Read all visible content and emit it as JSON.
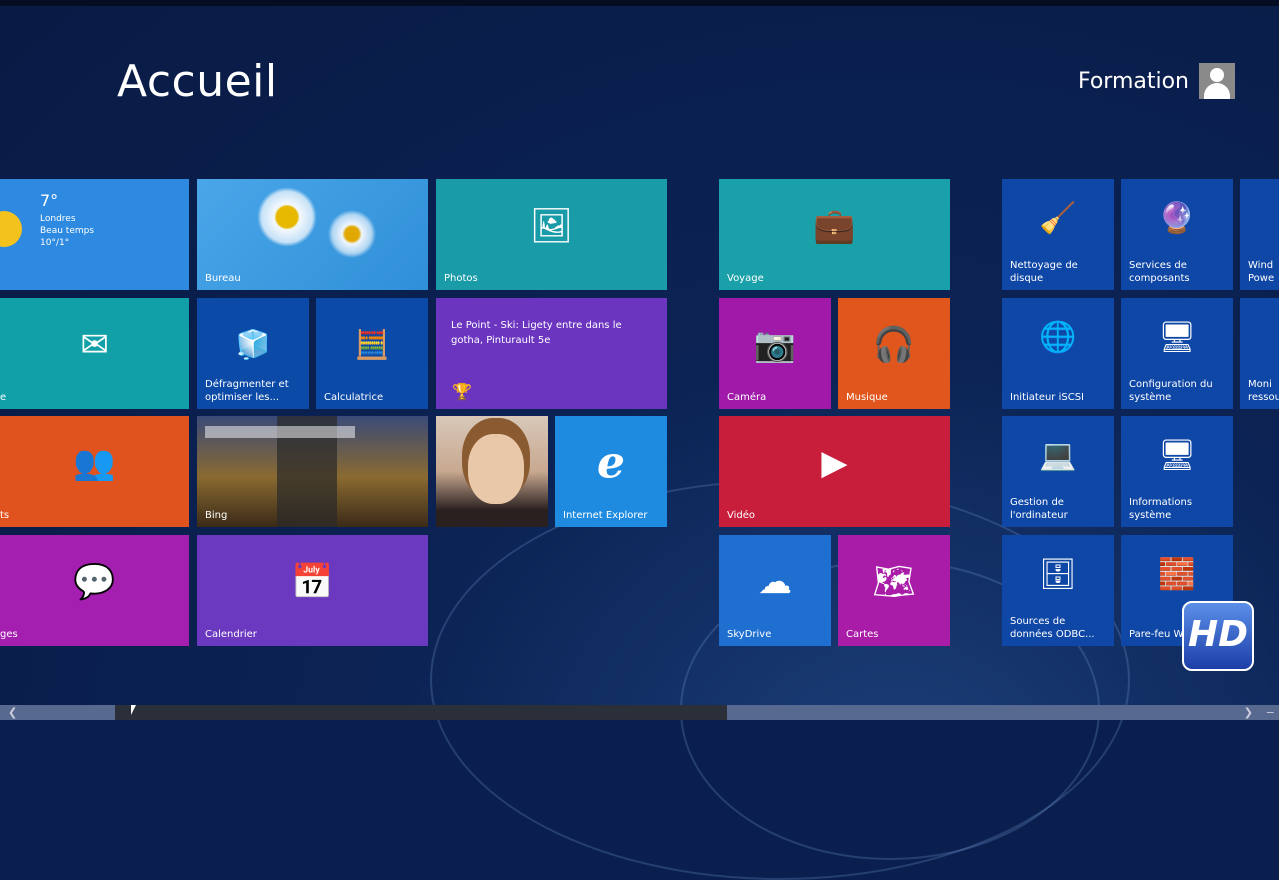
{
  "header": {
    "title": "Accueil",
    "user": "Formation"
  },
  "weather": {
    "temp": "7°",
    "city": "Londres",
    "condition": "Beau temps",
    "range": "10°/1°"
  },
  "tiles": {
    "bureau": "Bureau",
    "photos": "Photos",
    "mail": "e",
    "defrag": "Défragmenter et optimiser les...",
    "calc": "Calculatrice",
    "news": "Le Point - Ski: Ligety entre dans le gotha, Pinturault 5e",
    "people": "ts",
    "bing": "Bing",
    "ie": "Internet Explorer",
    "messaging": "ges",
    "calendar": "Calendrier",
    "voyage": "Voyage",
    "camera": "Caméra",
    "music": "Musique",
    "video": "Vidéo",
    "skydrive": "SkyDrive",
    "cartes": "Cartes"
  },
  "admin_tiles": [
    {
      "label": "Nettoyage de disque"
    },
    {
      "label": "Services de composants"
    },
    {
      "label": "Wind Powe"
    },
    {
      "label": "Initiateur iSCSI"
    },
    {
      "label": "Configuration du système"
    },
    {
      "label": "Moni ressou"
    },
    {
      "label": "Gestion de l'ordinateur"
    },
    {
      "label": "Informations système"
    },
    {
      "label": "Sources de données ODBC..."
    },
    {
      "label": "Pare-feu Windows"
    }
  ],
  "watermark": "HD",
  "colors": {
    "background": "#0a1f4e",
    "admin": "#0f47a6",
    "accent": "#1e8be0"
  }
}
